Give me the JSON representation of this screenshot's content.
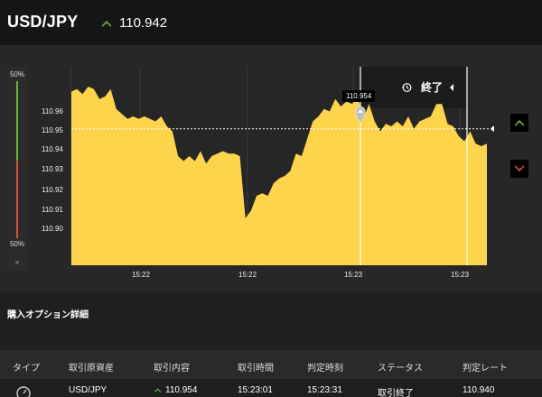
{
  "header": {
    "pair": "USD/JPY",
    "price": "110.942",
    "price_direction": "up"
  },
  "colors": {
    "up": "#6ab43a",
    "down": "#d65138",
    "chart_fill": "#ffd44d",
    "background": "#1f1f1f",
    "panel": "#272727"
  },
  "meter": {
    "top_label": "50%",
    "bottom_label": "50%",
    "close_label": "×"
  },
  "chart": {
    "y_ticks": [
      "110.96",
      "110.95",
      "110.94",
      "110.93",
      "110.92",
      "110.91",
      "110.90"
    ],
    "x_ticks": [
      "15:22",
      "15:22",
      "15:23",
      "15:23"
    ],
    "end_label": "終了",
    "tooltip": "110.954",
    "current_price_line": 110.942
  },
  "chart_data": {
    "type": "area",
    "ylim": [
      110.887,
      110.967
    ],
    "y": [
      110.957,
      110.958,
      110.956,
      110.959,
      110.958,
      110.954,
      110.955,
      110.958,
      110.95,
      110.948,
      110.946,
      110.947,
      110.946,
      110.947,
      110.946,
      110.945,
      110.947,
      110.943,
      110.941,
      110.931,
      110.929,
      110.931,
      110.929,
      110.933,
      110.928,
      110.931,
      110.932,
      110.933,
      110.932,
      110.932,
      110.931,
      110.906,
      110.909,
      110.915,
      110.916,
      110.915,
      110.92,
      110.922,
      110.923,
      110.925,
      110.932,
      110.931,
      110.938,
      110.945,
      110.947,
      110.95,
      110.949,
      110.954,
      110.951,
      110.953,
      110.952,
      110.955,
      110.946,
      110.952,
      110.945,
      110.941,
      110.944,
      110.943,
      110.945,
      110.943,
      110.947,
      110.942,
      110.945,
      110.946,
      110.947,
      110.952,
      110.952,
      110.944,
      110.943,
      110.939,
      110.937,
      110.941,
      110.936,
      110.935,
      110.936
    ]
  },
  "buttons": {
    "call": "high",
    "put": "low"
  },
  "section": {
    "title": "購入オプション詳細"
  },
  "table": {
    "headers": [
      "タイプ",
      "取引原資産",
      "取引内容",
      "取引時間",
      "判定時刻",
      "ステータス",
      "判定レート"
    ],
    "row": {
      "asset": "USD/JPY",
      "trade": "110.954",
      "trade_time": "15:23:01",
      "judge_time": "15:23:31",
      "status": "取引終了",
      "judge_rate": "110.940"
    }
  }
}
